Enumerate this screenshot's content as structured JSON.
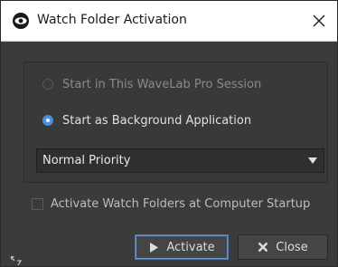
{
  "window": {
    "title": "Watch Folder Activation",
    "icon": "eye-icon",
    "close_icon": "close-icon"
  },
  "session_options": {
    "option_this_session": {
      "label": "Start in This WaveLab Pro Session",
      "selected": false,
      "enabled": false
    },
    "option_background": {
      "label": "Start as Background Application",
      "selected": true,
      "enabled": true
    },
    "priority_select": {
      "value": "Normal Priority"
    }
  },
  "startup_checkbox": {
    "label": "Activate Watch Folders at Computer Startup",
    "checked": false
  },
  "buttons": {
    "activate": {
      "label": "Activate",
      "icon": "play-icon"
    },
    "close": {
      "label": "Close",
      "icon": "close-x-icon"
    }
  },
  "colors": {
    "dialog_bg": "#3b3b3b",
    "accent": "#4a90d9",
    "text_bright": "#e0e0e0",
    "text_dim": "#8a8a8a"
  }
}
